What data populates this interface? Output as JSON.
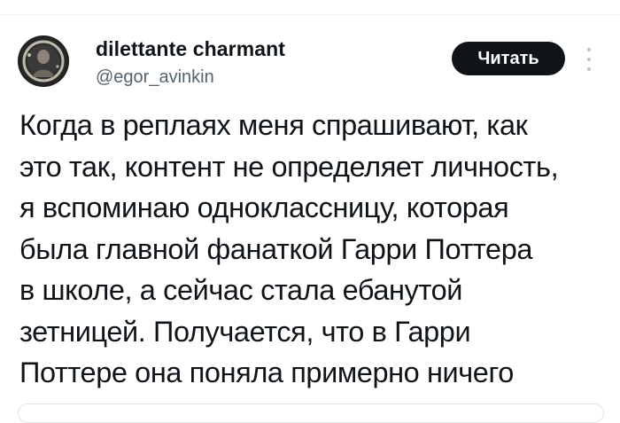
{
  "author": {
    "display_name": "dilettante charmant",
    "handle": "@egor_avinkin"
  },
  "follow_button": {
    "label": "Читать"
  },
  "icons": {
    "more": "more-vertical-icon",
    "avatar": "avatar"
  },
  "tweet": {
    "lines": [
      "Когда в реплаях меня спрашивают, как",
      "это так, контент не определяет личность,",
      "я вспоминаю одноклассницу, которая",
      "была главной фанаткой Гарри Поттера",
      "в школе, а сейчас стала ебанутой",
      "зетницей. Получается, что в Гарри",
      "Поттере она поняла примерно ничего"
    ]
  },
  "colors": {
    "text": "#0f1419",
    "secondary_text": "#536471",
    "button_bg": "#0f1419",
    "button_text": "#ffffff"
  }
}
